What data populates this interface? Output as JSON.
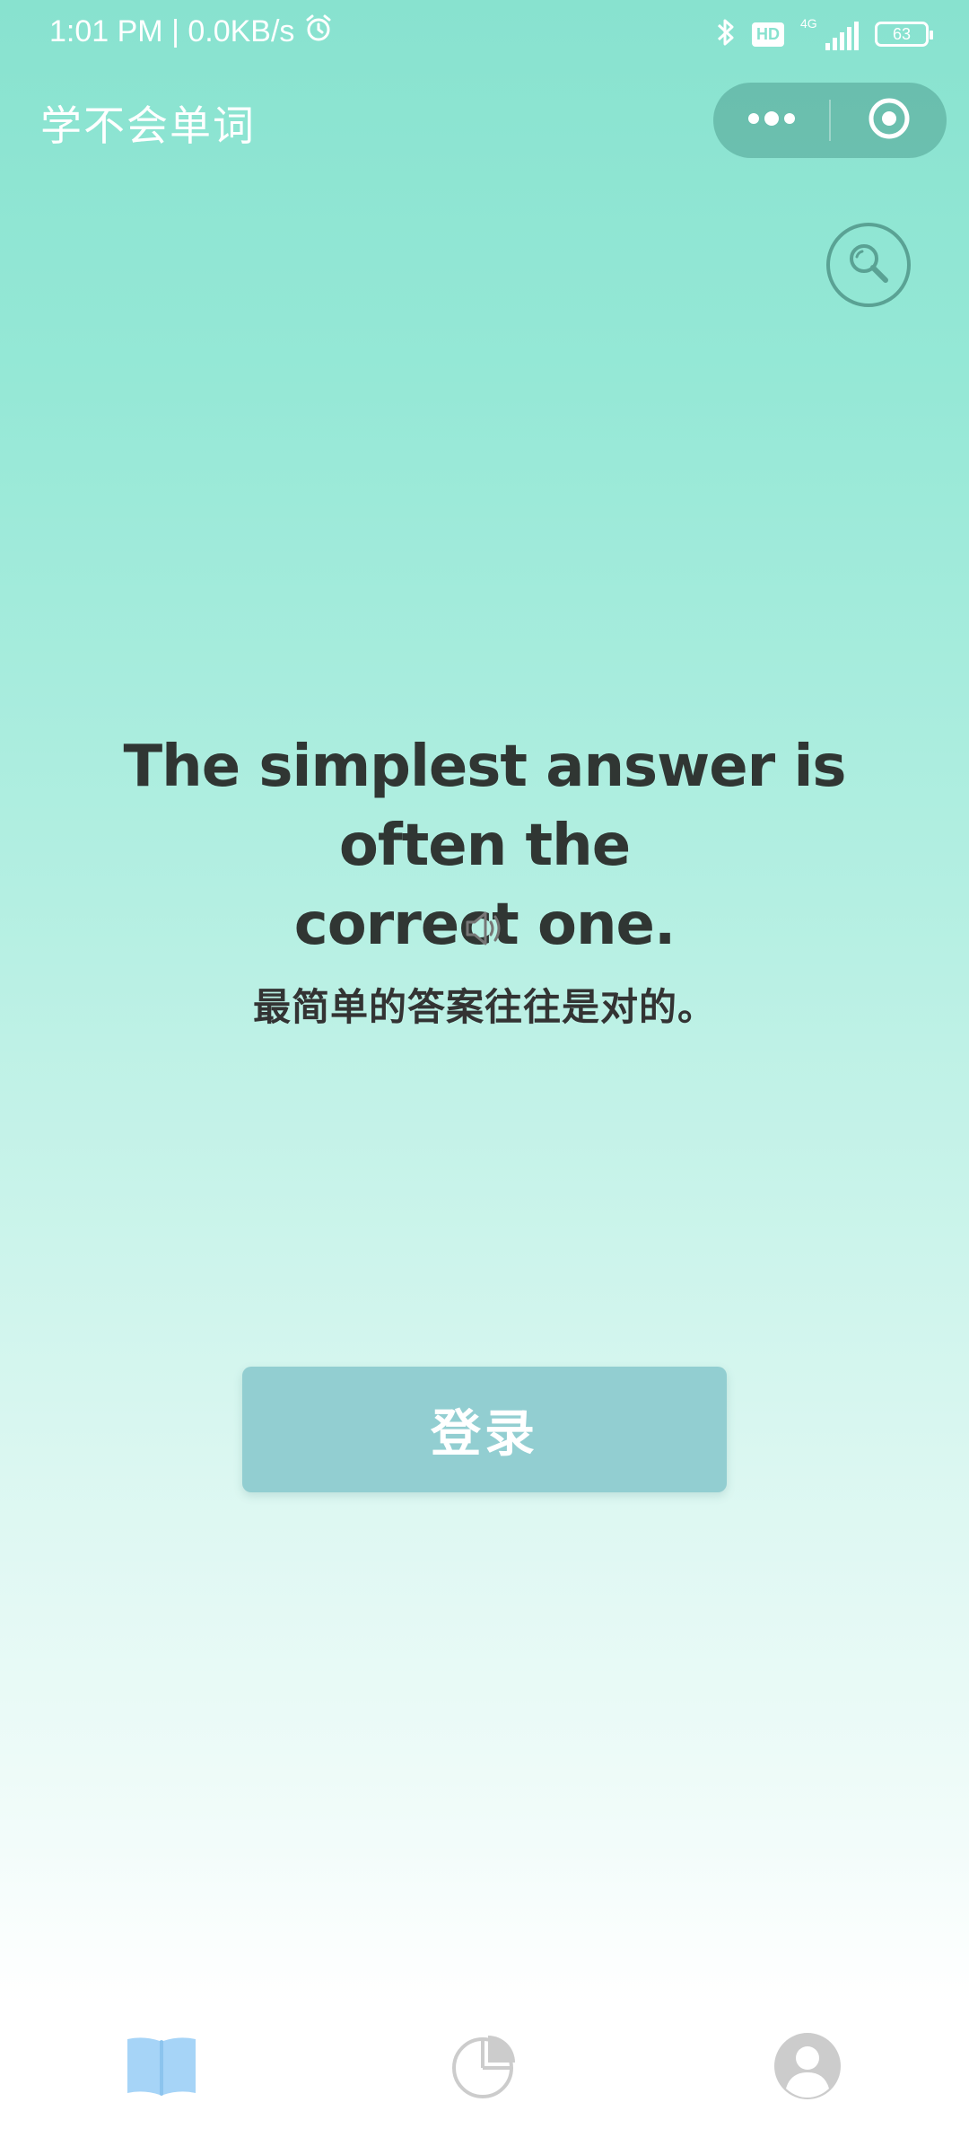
{
  "status_bar": {
    "time_speed": "1:01 PM | 0.0KB/s",
    "alarm_icon": "alarm-clock-icon",
    "bluetooth_icon": "bluetooth-icon",
    "hd_label": "HD",
    "network": "4G",
    "battery": "63"
  },
  "header": {
    "title": "学不会单词",
    "more_icon": "more-dots-icon",
    "close_icon": "target-close-icon"
  },
  "search": {
    "icon": "search-icon"
  },
  "sentence": {
    "english_line1": "The simplest answer is often the",
    "english_line2": "correct one.",
    "audio_icon": "speaker-icon",
    "chinese": "最简单的答案往往是对的。"
  },
  "login_button": {
    "label": "登录"
  },
  "tabbar": {
    "items": [
      {
        "icon": "book-icon",
        "active": true
      },
      {
        "icon": "pie-chart-icon",
        "active": false
      },
      {
        "icon": "user-avatar-icon",
        "active": false
      }
    ]
  },
  "colors": {
    "gradient_top": "#88e2cf",
    "button": "#92ced1",
    "active_tab": "#a6d4f7",
    "inactive_tab": "#cccccc"
  }
}
